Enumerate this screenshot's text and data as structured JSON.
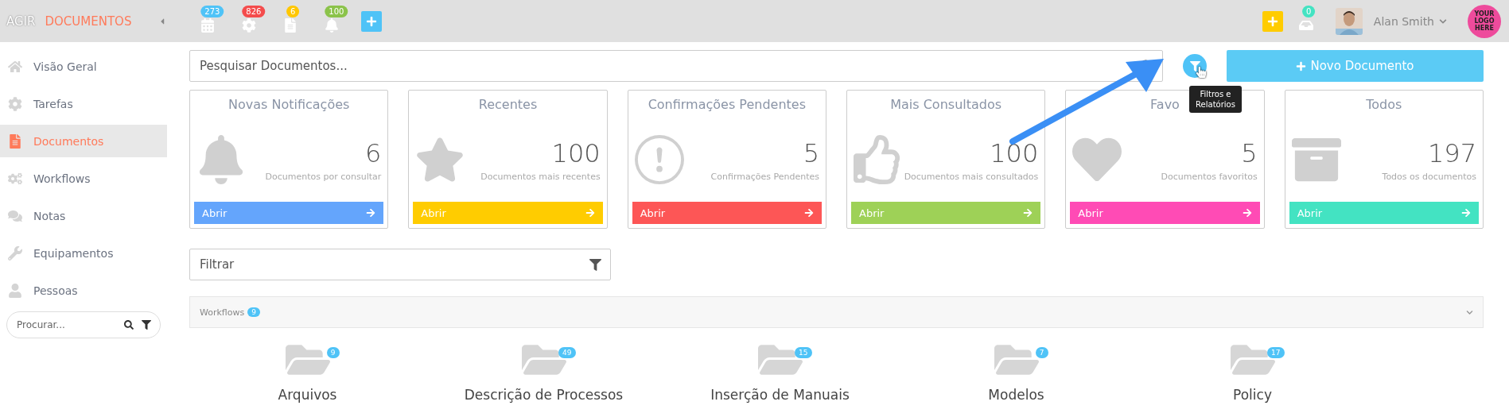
{
  "brand": {
    "prefix": "AGIR",
    "name": "DOCUMENTOS"
  },
  "top_icons": [
    {
      "kind": "calendar",
      "badge": "273",
      "color": "#4fc3f7"
    },
    {
      "kind": "gear",
      "badge": "826",
      "color": "#f44c4c"
    },
    {
      "kind": "document",
      "badge": "6",
      "color": "#ffc700"
    },
    {
      "kind": "bell",
      "badge": "100",
      "color": "#8bc34a"
    }
  ],
  "user": {
    "inbox_badge": "0",
    "name": "Alan Smith",
    "logo": [
      "YOUR",
      "LOGO",
      "HERE"
    ]
  },
  "sidebar": {
    "items": [
      {
        "kind": "home",
        "label": "Visão Geral",
        "selected": false
      },
      {
        "kind": "gear",
        "label": "Tarefas",
        "selected": false
      },
      {
        "kind": "document",
        "label": "Documentos",
        "selected": true
      },
      {
        "kind": "gears",
        "label": "Workflows",
        "selected": false
      },
      {
        "kind": "chat",
        "label": "Notas",
        "selected": false
      },
      {
        "kind": "wrench",
        "label": "Equipamentos",
        "selected": false
      },
      {
        "kind": "user",
        "label": "Pessoas",
        "selected": false
      }
    ],
    "search": {
      "placeholder": "Procurar..."
    }
  },
  "search": {
    "placeholder": "Pesquisar Documentos..."
  },
  "filter_tooltip": "Filtros e Relatórios",
  "new_button": "Novo Documento",
  "cards": [
    {
      "kind": "bell",
      "title": "Novas Notificações",
      "count": "6",
      "caption": "Documentos por consultar",
      "button": "Abrir",
      "color": "#64a5fc"
    },
    {
      "kind": "star",
      "title": "Recentes",
      "count": "100",
      "caption": "Documentos mais recentes",
      "button": "Abrir",
      "color": "#ffcc00"
    },
    {
      "kind": "alert",
      "title": "Confirmações Pendentes",
      "count": "5",
      "caption": "Confirmações Pendentes",
      "button": "Abrir",
      "color": "#fd5656"
    },
    {
      "kind": "thumb",
      "title": "Mais Consultados",
      "count": "100",
      "caption": "Documentos mais consultados",
      "button": "Abrir",
      "color": "#9ed157"
    },
    {
      "kind": "heart",
      "title": "Favo",
      "count": "5",
      "caption": "Documentos favoritos",
      "button": "Abrir",
      "color": "#ff4bb5"
    },
    {
      "kind": "archive",
      "title": "Todos",
      "count": "197",
      "caption": "Todos os documentos",
      "button": "Abrir",
      "color": "#43e3c2"
    }
  ],
  "filter": {
    "placeholder": "Filtrar"
  },
  "workflows": {
    "label": "Workflows",
    "count": "9"
  },
  "folders": [
    {
      "label": "Arquivos",
      "count": "9"
    },
    {
      "label": "Descrição de Processos",
      "count": "49"
    },
    {
      "label": "Inserção de Manuais",
      "count": "15"
    },
    {
      "label": "Modelos",
      "count": "7"
    },
    {
      "label": "Policy",
      "count": "17"
    }
  ]
}
